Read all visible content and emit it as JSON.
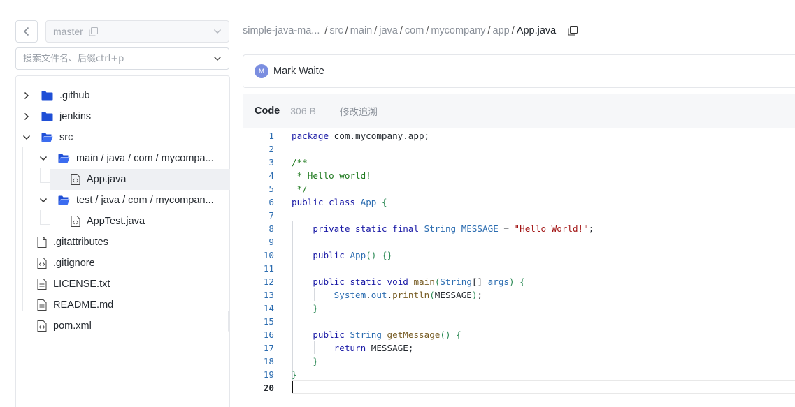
{
  "branch": {
    "value": "master"
  },
  "search": {
    "placeholder": "搜索文件名、后缀ctrl+p"
  },
  "tree": [
    {
      "label": ".github",
      "type": "folder",
      "state": "collapsed"
    },
    {
      "label": "jenkins",
      "type": "folder",
      "state": "collapsed"
    },
    {
      "label": "src",
      "type": "folder",
      "state": "expanded"
    },
    {
      "label": "main / java / com / mycompa...",
      "type": "folder",
      "state": "expanded"
    },
    {
      "label": "App.java",
      "type": "code-file",
      "selected": true
    },
    {
      "label": "test / java / com / mycompan...",
      "type": "folder",
      "state": "expanded"
    },
    {
      "label": "AppTest.java",
      "type": "code-file"
    },
    {
      "label": ".gitattributes",
      "type": "file"
    },
    {
      "label": ".gitignore",
      "type": "code-file"
    },
    {
      "label": "LICENSE.txt",
      "type": "file"
    },
    {
      "label": "README.md",
      "type": "file"
    },
    {
      "label": "pom.xml",
      "type": "code-file"
    }
  ],
  "breadcrumb": {
    "repo": "simple-java-ma...",
    "parts": [
      "src",
      "main",
      "java",
      "com",
      "mycompany",
      "app"
    ],
    "current": "App.java"
  },
  "author": {
    "initial": "M",
    "name": "Mark Waite"
  },
  "code": {
    "tab": "Code",
    "size": "306 B",
    "blame": "修改追溯",
    "active_line": 20,
    "lines": [
      "package com.mycompany.app;",
      "",
      "/**",
      " * Hello world!",
      " */",
      "public class App {",
      "",
      "    private static final String MESSAGE = \"Hello World!\";",
      "",
      "    public App() {}",
      "",
      "    public static void main(String[] args) {",
      "        System.out.println(MESSAGE);",
      "    }",
      "",
      "    public String getMessage() {",
      "        return MESSAGE;",
      "    }",
      "}",
      ""
    ]
  },
  "colors": {
    "keyword": "#1a1aa6",
    "type": "#2b6cb0",
    "comment": "#1f7a1f",
    "string": "#a31515",
    "folder": "#1f4fd6"
  }
}
